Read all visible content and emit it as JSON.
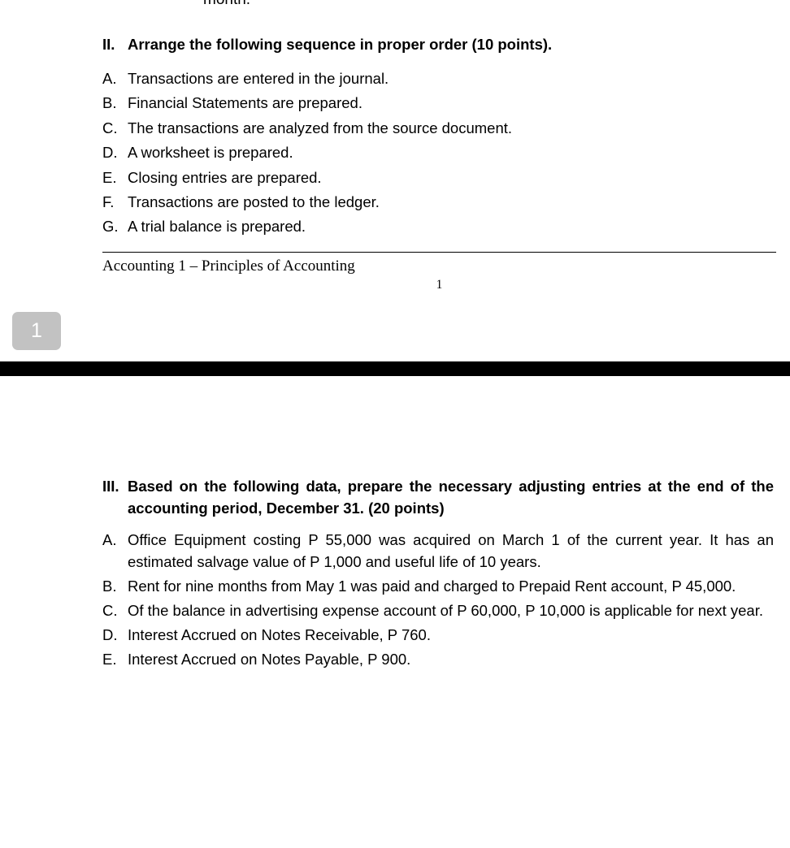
{
  "document": {
    "clipped_top_line": "month.",
    "section_two": {
      "marker": "II.",
      "heading": "Arrange the following sequence in proper order (10 points).",
      "options": [
        {
          "marker": "A.",
          "text": "Transactions are entered in the journal."
        },
        {
          "marker": "B.",
          "text": "Financial Statements are prepared."
        },
        {
          "marker": "C.",
          "text": "The transactions are analyzed from the source document."
        },
        {
          "marker": "D.",
          "text": "A worksheet is prepared."
        },
        {
          "marker": "E.",
          "text": "Closing entries are prepared."
        },
        {
          "marker": "F.",
          "text": "Transactions are posted to the ledger."
        },
        {
          "marker": "G.",
          "text": "A trial balance is prepared."
        }
      ]
    },
    "footer": {
      "title": "Accounting 1 – Principles of Accounting",
      "page_number": "1"
    },
    "page_badge": {
      "label": "1",
      "background_color": "#c2c2c2",
      "text_color": "#ffffff"
    },
    "section_three": {
      "marker": "III.",
      "heading": "Based on the following data, prepare the necessary adjusting entries at the end of the accounting period, December 31. (20 points)",
      "items": [
        {
          "marker": "A.",
          "text": "Office Equipment costing P 55,000 was acquired on March 1 of the current   year.   It has an estimated salvage value of P 1,000 and useful life of 10 years."
        },
        {
          "marker": "B.",
          "text": "Rent for nine months from May 1 was paid and charged to Prepaid  Rent  account,  P 45,000."
        },
        {
          "marker": "C.",
          "text": "Of the balance in advertising expense account of P 60,000, P 10,000 is applicable for next year."
        },
        {
          "marker": "D.",
          "text": "Interest Accrued on Notes Receivable, P 760."
        },
        {
          "marker": "E.",
          "text": "Interest Accrued on Notes Payable, P 900."
        }
      ]
    }
  }
}
